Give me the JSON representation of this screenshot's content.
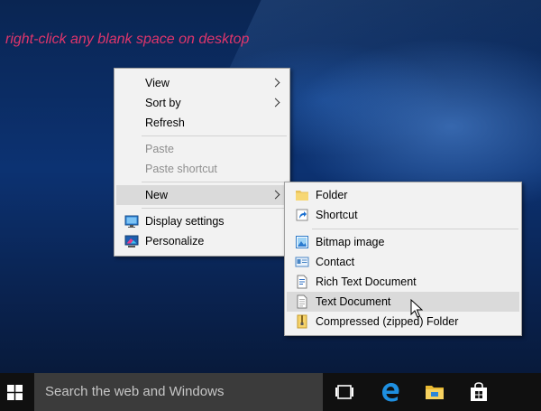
{
  "caption": "right-click any blank space on desktop",
  "context_menu": {
    "items": [
      {
        "label": "View"
      },
      {
        "label": "Sort by"
      },
      {
        "label": "Refresh"
      },
      {
        "label": "Paste"
      },
      {
        "label": "Paste shortcut"
      },
      {
        "label": "New"
      },
      {
        "label": "Display settings"
      },
      {
        "label": "Personalize"
      }
    ]
  },
  "new_submenu": {
    "items": [
      {
        "label": "Folder",
        "icon": "folder-icon"
      },
      {
        "label": "Shortcut",
        "icon": "shortcut-icon"
      },
      {
        "label": "Bitmap image",
        "icon": "bitmap-icon"
      },
      {
        "label": "Contact",
        "icon": "contact-icon"
      },
      {
        "label": "Rich Text Document",
        "icon": "rich-text-icon"
      },
      {
        "label": "Text Document",
        "icon": "text-document-icon"
      },
      {
        "label": "Compressed (zipped) Folder",
        "icon": "zip-folder-icon"
      }
    ]
  },
  "taskbar": {
    "search_placeholder": "Search the web and Windows",
    "icons": [
      "windows-logo-icon",
      "task-view-icon",
      "edge-icon",
      "file-explorer-icon",
      "store-icon"
    ]
  },
  "colors": {
    "caption": "#e0356b",
    "menu_bg": "#f2f2f2",
    "hover_bg": "#dadada",
    "taskbar": "#101010",
    "search_bg": "#3b3b3b",
    "accent_blue": "#1e8fe0"
  }
}
